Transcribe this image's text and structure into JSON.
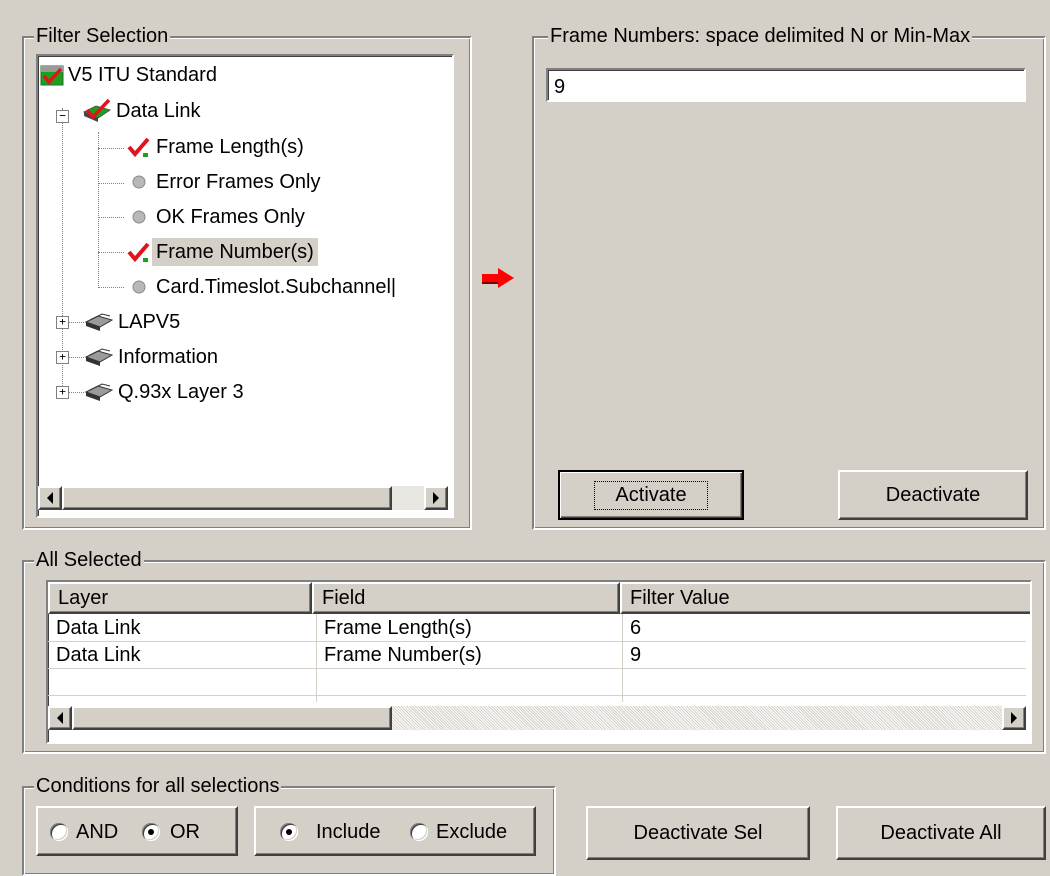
{
  "filter_selection": {
    "title": "Filter Selection",
    "tree": {
      "root": "V5 ITU Standard",
      "data_link": "Data Link",
      "children": [
        "Frame Length(s)",
        "Error Frames Only",
        "OK Frames Only",
        "Frame Number(s)",
        "Card.Timeslot.Subchannel|"
      ],
      "others": [
        "LAPV5",
        "Information",
        "Q.93x Layer 3"
      ],
      "selected": "Frame Number(s)"
    }
  },
  "frame_numbers": {
    "title": "Frame Numbers: space delimited N or Min-Max",
    "value": "9",
    "activate_label": "Activate",
    "deactivate_label": "Deactivate"
  },
  "all_selected": {
    "title": "All Selected",
    "columns": [
      "Layer",
      "Field",
      "Filter Value"
    ],
    "rows": [
      [
        "Data Link",
        "Frame Length(s)",
        "6"
      ],
      [
        "Data Link",
        "Frame Number(s)",
        "9"
      ]
    ]
  },
  "conditions": {
    "title": "Conditions for all selections",
    "and_label": "AND",
    "or_label": "OR",
    "include_label": "Include",
    "exclude_label": "Exclude",
    "logic": "OR",
    "mode": "Include"
  },
  "buttons": {
    "deactivate_sel": "Deactivate Sel",
    "deactivate_all": "Deactivate All"
  },
  "colors": {
    "check": "#e0141c",
    "check_green": "#1aa01a",
    "arrow": "#ff0000"
  }
}
